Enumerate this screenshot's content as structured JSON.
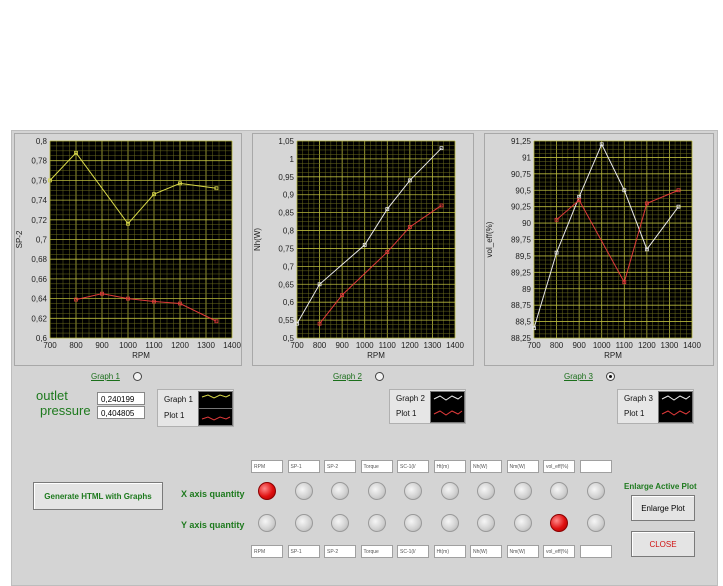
{
  "graphs": [
    {
      "tab_label": "Graph 1",
      "selected": false,
      "legend": {
        "graph": "Graph 1",
        "plot": "Plot 1"
      },
      "chart_data": {
        "type": "line",
        "xlabel": "RPM",
        "ylabel": "SP-2",
        "xlim": [
          700,
          1400
        ],
        "ylim": [
          0.6,
          0.8
        ],
        "xticks": [
          "700",
          "800",
          "900",
          "1000",
          "1100",
          "1200",
          "1300",
          "1400"
        ],
        "yticks": [
          "0,6",
          "0,62",
          "0,64",
          "0,66",
          "0,68",
          "0,7",
          "0,72",
          "0,74",
          "0,76",
          "0,78",
          "0,8"
        ],
        "series": [
          {
            "color": "#d8d84a",
            "x": [
              700,
              800,
              1000,
              1100,
              1200,
              1340
            ],
            "y": [
              0.76,
              0.788,
              0.716,
              0.746,
              0.757,
              0.752
            ]
          },
          {
            "color": "#e03a3a",
            "x": [
              800,
              900,
              1000,
              1100,
              1200,
              1340
            ],
            "y": [
              0.639,
              0.645,
              0.64,
              0.637,
              0.635,
              0.617
            ]
          }
        ]
      }
    },
    {
      "tab_label": "Graph 2",
      "selected": false,
      "legend": {
        "graph": "Graph 2",
        "plot": "Plot 1"
      },
      "chart_data": {
        "type": "line",
        "xlabel": "RPM",
        "ylabel": "Nh(W)",
        "xlim": [
          700,
          1400
        ],
        "ylim": [
          0.5,
          1.05
        ],
        "xticks": [
          "700",
          "800",
          "900",
          "1000",
          "1100",
          "1200",
          "1300",
          "1400"
        ],
        "yticks": [
          "0,5",
          "0,55",
          "0,6",
          "0,65",
          "0,7",
          "0,75",
          "0,8",
          "0,85",
          "0,9",
          "0,95",
          "1",
          "1,05"
        ],
        "series": [
          {
            "color": "#e8e8e8",
            "x": [
              700,
              800,
              1000,
              1100,
              1200,
              1340
            ],
            "y": [
              0.54,
              0.65,
              0.76,
              0.86,
              0.94,
              1.03
            ]
          },
          {
            "color": "#e03a3a",
            "x": [
              800,
              900,
              1100,
              1200,
              1340
            ],
            "y": [
              0.54,
              0.62,
              0.74,
              0.81,
              0.87
            ]
          }
        ]
      }
    },
    {
      "tab_label": "Graph 3",
      "selected": true,
      "legend": {
        "graph": "Graph 3",
        "plot": "Plot 1"
      },
      "chart_data": {
        "type": "line",
        "xlabel": "RPM",
        "ylabel": "vol_eff(%)",
        "xlim": [
          700,
          1400
        ],
        "ylim": [
          88.25,
          91.25
        ],
        "xticks": [
          "700",
          "800",
          "900",
          "1000",
          "1100",
          "1200",
          "1300",
          "1400"
        ],
        "yticks": [
          "88,25",
          "88,5",
          "88,75",
          "89",
          "89,25",
          "89,5",
          "89,75",
          "90",
          "90,25",
          "90,5",
          "90,75",
          "91",
          "91,25"
        ],
        "series": [
          {
            "color": "#e8e8e8",
            "x": [
              700,
              800,
              900,
              1000,
              1100,
              1200,
              1340
            ],
            "y": [
              88.4,
              89.55,
              90.4,
              91.2,
              90.5,
              89.6,
              90.25
            ]
          },
          {
            "color": "#e03a3a",
            "x": [
              800,
              900,
              1100,
              1200,
              1340
            ],
            "y": [
              90.05,
              90.35,
              89.1,
              90.3,
              90.5
            ]
          }
        ]
      }
    }
  ],
  "outlet": {
    "label_line1": "outlet",
    "label_line2": "pressure",
    "value1": "0,240199",
    "value2": "0,404805"
  },
  "buttons": {
    "generate": "Generate HTML with Graphs",
    "enlarge_title": "Enlarge Active Plot",
    "enlarge": "Enlarge Plot",
    "close": "CLOSE"
  },
  "axis_labels": {
    "x": "X axis quantity",
    "y": "Y axis quantity"
  },
  "quantities": [
    "RPM",
    "SP-1",
    "SP-2",
    "Torque",
    "SC-1(l/",
    "Ht(m)",
    "Nh(W)",
    "Nm(W)",
    "vol_eff(%)",
    ""
  ],
  "x_selected_index": 0,
  "y_selected_index": 8
}
